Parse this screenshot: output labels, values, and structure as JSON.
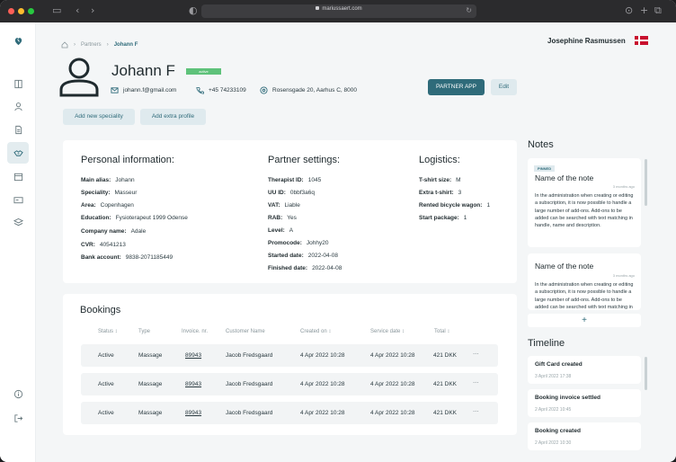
{
  "browser": {
    "url": "mariussaert.com",
    "traffic_colors": [
      "#fe5f57",
      "#febc2e",
      "#28c840"
    ]
  },
  "sidebar": {
    "logo": "brand-logo",
    "items": [
      {
        "icon": "document-icon"
      },
      {
        "icon": "user-icon"
      },
      {
        "icon": "file-icon"
      },
      {
        "icon": "handshake-icon",
        "active": true
      },
      {
        "icon": "calendar-icon"
      },
      {
        "icon": "card-icon"
      },
      {
        "icon": "layers-icon"
      }
    ],
    "bottom": [
      {
        "icon": "info-icon"
      },
      {
        "icon": "logout-icon"
      }
    ]
  },
  "breadcrumb": {
    "home_icon": "home-icon",
    "parent": "Partners",
    "current": "Johann F"
  },
  "user": {
    "name": "Josephine Rasmussen",
    "flag": "denmark-flag"
  },
  "profile": {
    "name": "Johann F",
    "status": "active",
    "email": "johann.f@gmail.com",
    "phone": "+45 74233109",
    "address": "Rosensgade 20, Aarhus C, 8000"
  },
  "actions": {
    "partner_app": "PARTNER APP",
    "edit": "Edit",
    "add_speciality": "Add new speciality",
    "add_profile": "Add extra profile"
  },
  "personal": {
    "title": "Personal information:",
    "fields": [
      {
        "label": "Main alias:",
        "value": "Johann"
      },
      {
        "label": "Speciality:",
        "value": "Masseur"
      },
      {
        "label": "Area:",
        "value": "Copenhagen"
      },
      {
        "label": "Education:",
        "value": "Fysioterapeut 1999 Odense"
      },
      {
        "label": "Company name:",
        "value": "Adale"
      },
      {
        "label": "CVR:",
        "value": "40541213"
      },
      {
        "label": "Bank account:",
        "value": "9838-2071185449"
      }
    ]
  },
  "partner": {
    "title": "Partner settings:",
    "fields": [
      {
        "label": "Therapist ID:",
        "value": "1045"
      },
      {
        "label": "UU ID:",
        "value": "0bbf3a6q"
      },
      {
        "label": "VAT:",
        "value": "Liable"
      },
      {
        "label": "RAB:",
        "value": "Yes"
      },
      {
        "label": "Level:",
        "value": "A"
      },
      {
        "label": "Promocode:",
        "value": "Johhy20"
      },
      {
        "label": "Started date:",
        "value": "2022-04-08"
      },
      {
        "label": "Finished date:",
        "value": "2022-04-08"
      }
    ]
  },
  "logistics": {
    "title": "Logistics:",
    "fields": [
      {
        "label": "T-shirt size:",
        "value": "M"
      },
      {
        "label": "Extra t-shirt:",
        "value": "3"
      },
      {
        "label": "Rented bicycle wagon:",
        "value": "1"
      },
      {
        "label": "Start package:",
        "value": "1"
      }
    ]
  },
  "bookings": {
    "title": "Bookings",
    "columns": [
      "Status ↕",
      "Type",
      "Invoice. nr.",
      "Customer Name",
      "Created on ↕",
      "Service date ↕",
      "Total ↕"
    ],
    "rows": [
      {
        "status": "Active",
        "type": "Massage",
        "invoice": "89943",
        "customer": "Jacob Fredsgaard",
        "created": "4 Apr 2022 10:28",
        "service": "4 Apr 2022 10:28",
        "total": "421 DKK",
        "more": "···"
      },
      {
        "status": "Active",
        "type": "Massage",
        "invoice": "89943",
        "customer": "Jacob Fredsgaard",
        "created": "4 Apr 2022 10:28",
        "service": "4 Apr 2022 10:28",
        "total": "421 DKK",
        "more": "···"
      },
      {
        "status": "Active",
        "type": "Massage",
        "invoice": "89943",
        "customer": "Jacob Fredsgaard",
        "created": "4 Apr 2022 10:28",
        "service": "4 Apr 2022 10:28",
        "total": "421 DKK",
        "more": "···"
      }
    ]
  },
  "notes": {
    "title": "Notes",
    "add": "+",
    "items": [
      {
        "pinned": "PINNED",
        "title": "Name of the note",
        "time": "3 months ago",
        "body": "In the administration when creating or editing a subscription, it is now possible to handle a large number of add-ons. Add-ons to be added can be searched with text matching in handle, name and description."
      },
      {
        "title": "Name of the note",
        "time": "3 months ago",
        "body": "In the administration when creating or editing a subscription, it is now possible to handle a large number of add-ons. Add-ons to be added can be searched with text matching in handle, name and description."
      }
    ]
  },
  "timeline": {
    "title": "Timeline",
    "items": [
      {
        "title": "Gift Card created",
        "time": "3 April 2022 17:38"
      },
      {
        "title": "Booking invoice settled",
        "time": "2 April 2022 10:45"
      },
      {
        "title": "Booking created",
        "time": "2 April 2022 10:30"
      }
    ]
  }
}
